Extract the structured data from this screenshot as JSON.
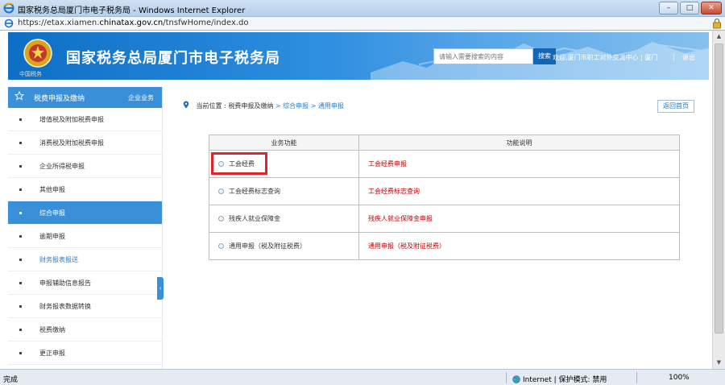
{
  "window": {
    "title": "国家税务总局厦门市电子税务局 - Windows Internet Explorer",
    "controls": [
      "–",
      "□",
      "✕"
    ],
    "address_prefix": "https://etax.xiamen.",
    "address_domain": "chinatax.gov.cn",
    "address_path": "/tnsfwHome/index.do"
  },
  "header": {
    "site_title": "国家税务总局厦门市电子税务局",
    "emblem_subtext": "中国税务",
    "search_placeholder": "请输入需要搜索的内容",
    "search_button": "搜索",
    "welcome": "欢迎,厦门市职工对外交流中心 | 厦门",
    "logout": "退出"
  },
  "sidebar": {
    "header_label": "税费申报及缴纳",
    "header_extra": "企业业务",
    "items": [
      {
        "label": "增值税及附加税费申报"
      },
      {
        "label": "消费税及附加税费申报"
      },
      {
        "label": "企业所得税申报"
      },
      {
        "label": "其他申报"
      },
      {
        "label": "综合申报"
      },
      {
        "label": "逾期申报"
      },
      {
        "label": "财务报表报送"
      },
      {
        "label": "申报辅助信息报告"
      },
      {
        "label": "财务报表数据转换"
      },
      {
        "label": "税费缴纳"
      },
      {
        "label": "更正申报"
      }
    ],
    "active_index": 4,
    "collapse_glyph": "‹"
  },
  "breadcrumb": {
    "label": "当前位置 :",
    "level1": "税费申报及缴纳",
    "level2": "> 综合申报",
    "level3": "> 通用申报"
  },
  "home_button": "返回首页",
  "table": {
    "headers": [
      "业务功能",
      "功能说明"
    ],
    "rows": [
      {
        "option": "工会经费",
        "desc": "工会经费申报"
      },
      {
        "option": "工会经费标志查询",
        "desc": "工会经费标志查询"
      },
      {
        "option": "残疾人就业保障金",
        "desc": "残疾人就业保障金申报"
      },
      {
        "option": "通用申报（税及附征税费）",
        "desc": "通用申报（税及附征税费）"
      }
    ]
  },
  "statusbar": {
    "status": "完成",
    "zone": "Internet | 保护模式: 禁用",
    "zoom": "100%"
  },
  "colors": {
    "accent": "#3a90d8",
    "highlight": "#e0242a",
    "desc_text": "#c00000"
  }
}
